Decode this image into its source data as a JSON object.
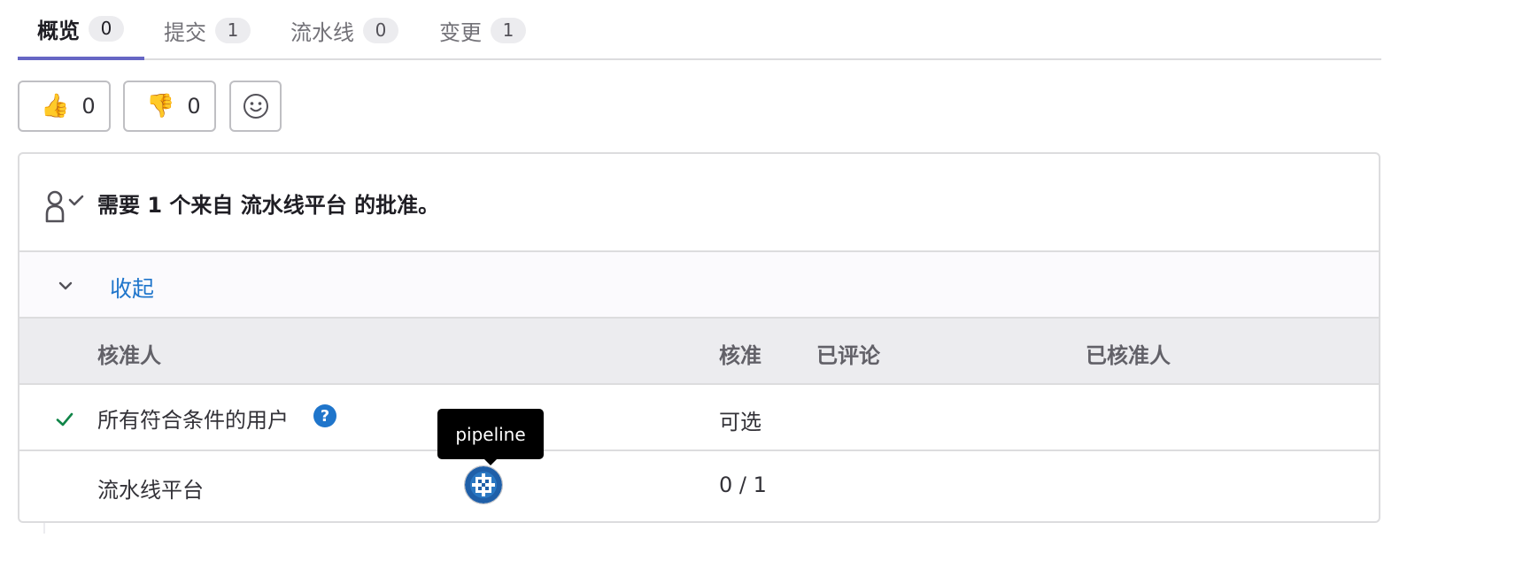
{
  "tabs": [
    {
      "label": "概览",
      "count": "0"
    },
    {
      "label": "提交",
      "count": "1"
    },
    {
      "label": "流水线",
      "count": "0"
    },
    {
      "label": "变更",
      "count": "1"
    }
  ],
  "awards": {
    "thumbsup": {
      "icon": "thumbs-up-icon",
      "emoji": "👍",
      "count": "0"
    },
    "thumbsdown": {
      "icon": "thumbs-down-icon",
      "emoji": "👎",
      "count": "0"
    },
    "add_reaction_icon": "smiley-icon"
  },
  "approvals": {
    "summary": "需要 1 个来自 流水线平台 的批准。",
    "collapse_label": "收起",
    "columns": {
      "approvers": "核准人",
      "approval": "核准",
      "commented": "已评论",
      "approved_by": "已核准人"
    },
    "rows": [
      {
        "name": "所有符合条件的用户",
        "approval": "可选"
      },
      {
        "name": "流水线平台",
        "approval": "0 / 1"
      }
    ],
    "tooltip": "pipeline"
  },
  "colors": {
    "accent": "#6666c4",
    "link": "#1f75cb",
    "success": "#108548"
  }
}
